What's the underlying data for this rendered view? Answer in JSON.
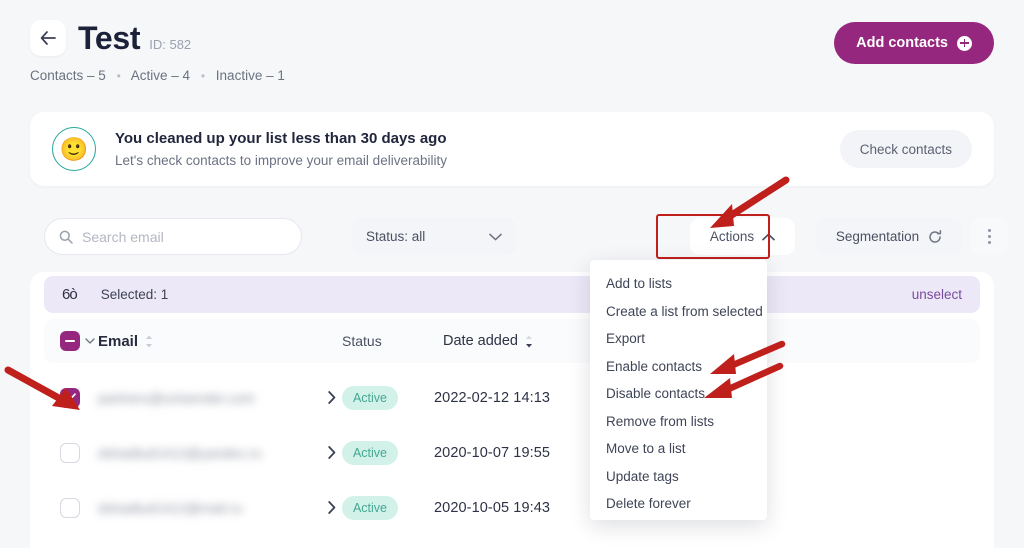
{
  "header": {
    "back_icon": "arrow-left-icon",
    "title": "Test",
    "id_label": "ID: 582",
    "meta": {
      "contacts": "Contacts – 5",
      "sep": "•",
      "active": "Active – 4",
      "inactive": "Inactive – 1"
    },
    "add_button": "Add contacts",
    "add_button_icon": "plus-circle-icon",
    "accent_color": "#96277f"
  },
  "banner": {
    "emoji": "🙂",
    "title": "You cleaned up your list less than 30 days ago",
    "subtitle": "Let's check contacts to improve your email deliverability",
    "check_button": "Check contacts",
    "ring_color": "#27a79a"
  },
  "toolbar": {
    "search_placeholder": "Search email",
    "search_value": "",
    "search_icon": "search-icon",
    "status_label": "Status: all",
    "status_icon": "chevron-down-icon",
    "actions_label": "Actions",
    "actions_icon": "chevron-up-icon",
    "segmentation_label": "Segmentation",
    "segmentation_icon": "refresh-icon",
    "kebab_icon": "more-vertical-icon"
  },
  "selection_bar": {
    "icon": "glasses-icon",
    "glyph": "6ò",
    "label": "Selected: 1",
    "unselect_label": "unselect",
    "background": "#ece8f8"
  },
  "table": {
    "columns": {
      "email": "Email",
      "status": "Status",
      "date_added": "Date added"
    },
    "sort_icon": "sort-arrows-icon",
    "select_all_state": "indeterminate",
    "rows": [
      {
        "checked": true,
        "email": "partners@unisender.com",
        "status": "Active",
        "date": "2022-02-12 14:13"
      },
      {
        "checked": false,
        "email": "dshadlud1412@yandex.ru",
        "status": "Active",
        "date": "2020-10-07 19:55"
      },
      {
        "checked": false,
        "email": "dshadlud1412@mail.ru",
        "status": "Active",
        "date": "2020-10-05 19:43"
      }
    ],
    "badge_colors": {
      "background": "#d2f1e9",
      "text": "#44a894"
    }
  },
  "actions_menu": {
    "items": [
      "Add to lists",
      "Create a list from selected",
      "Export",
      "Enable contacts",
      "Disable contacts",
      "Remove from lists",
      "Move to a list",
      "Update tags",
      "Delete forever"
    ]
  },
  "annotations": {
    "highlight_color": "#c0201c",
    "arrow_count": 4
  }
}
